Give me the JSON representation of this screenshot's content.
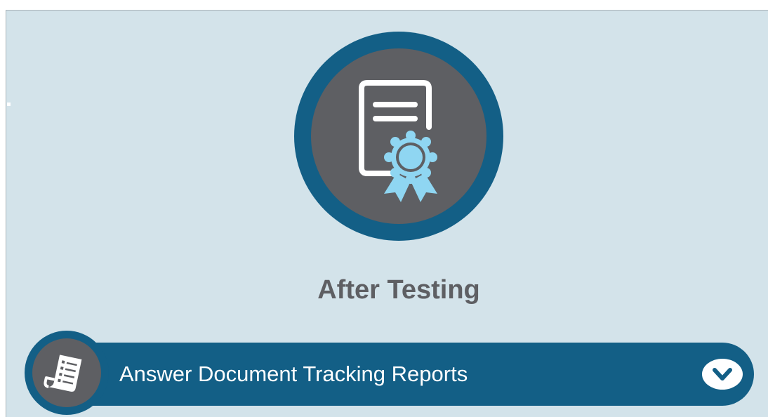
{
  "section": {
    "title": "After Testing",
    "hero_icon": "certificate-document-icon"
  },
  "report_item": {
    "label": "Answer Document Tracking Reports",
    "icon": "report-document-icon",
    "expand_icon": "chevron-down-icon"
  },
  "colors": {
    "background": "#d3e3ea",
    "ring": "#135f86",
    "circle_fill": "#5e5f63",
    "badge_accent": "#8fd6f2",
    "title_text": "#5e5f63",
    "label_text": "#ffffff"
  }
}
